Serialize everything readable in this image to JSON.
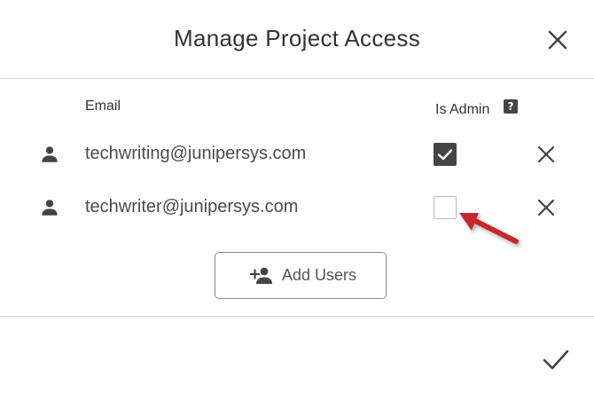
{
  "dialog": {
    "title": "Manage Project Access"
  },
  "columns": {
    "email": "Email",
    "is_admin": "Is Admin",
    "help_symbol": "?"
  },
  "users": [
    {
      "email": "techwriting@junipersys.com",
      "is_admin": true
    },
    {
      "email": "techwriter@junipersys.com",
      "is_admin": false
    }
  ],
  "add_users": {
    "label": "Add Users"
  },
  "icons": {
    "close": "close-icon",
    "user": "person-icon",
    "remove": "remove-icon",
    "help": "help-icon",
    "add_user": "person-add-icon",
    "confirm": "checkmark-icon",
    "annotation": "arrow-annotation"
  },
  "colors": {
    "icon_gray": "#444444",
    "annotation_red": "#c8282a"
  }
}
